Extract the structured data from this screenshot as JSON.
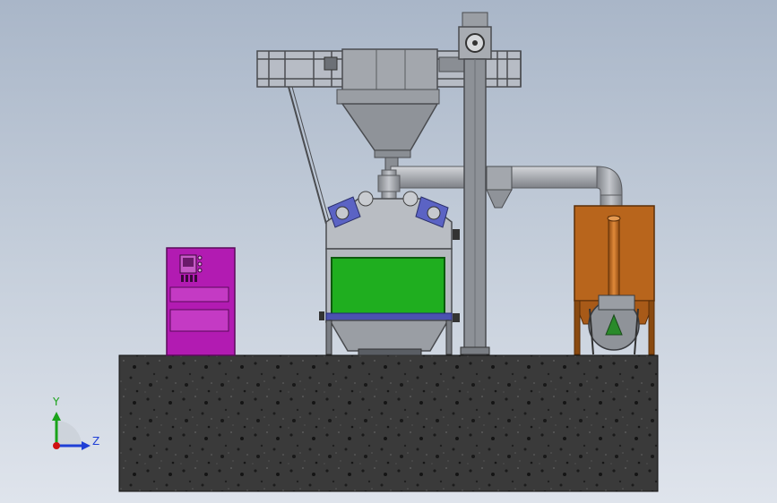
{
  "viewport": {
    "background_top": "#a9b6c8",
    "background_bottom": "#dfe4ec"
  },
  "triad": {
    "y_label": "Y",
    "z_label": "Z",
    "y_color": "#1aa31a",
    "z_color": "#1f3fd6",
    "x_color": "#d01010"
  },
  "model": {
    "control_cabinet_color": "#b21bb2",
    "machine_window_color": "#1fae1f",
    "dust_collector_color": "#b8651c",
    "base_color": "#2b2b2b",
    "steel_color": "#8d8f93"
  }
}
